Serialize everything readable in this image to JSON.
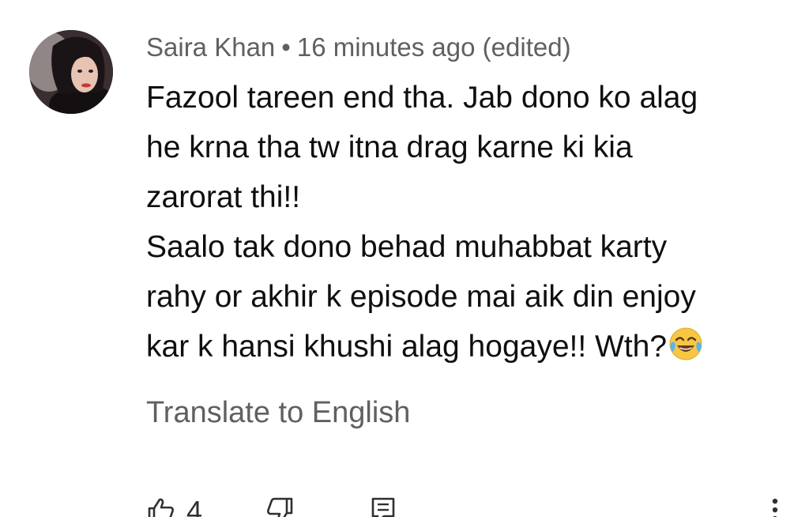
{
  "comment": {
    "author": "Saira Khan",
    "separator": "•",
    "timestamp": "16 minutes ago (edited)",
    "lines": [
      "Fazool tareen end tha. Jab dono ko alag",
      "he krna tha tw itna drag karne ki kia",
      "zarorat thi!!",
      "Saalo tak dono behad muhabbat karty",
      "rahy or akhir k episode mai aik din enjoy",
      "kar k hansi khushi alag hogaye!! Wth?"
    ],
    "emoji_icon": "face-with-tears-of-joy-icon",
    "translate_label": "Translate to English",
    "like_count": "4"
  },
  "icons": {
    "like": "thumbs-up-icon",
    "dislike": "thumbs-down-icon",
    "reply": "reply-icon",
    "more": "more-vert-icon"
  },
  "colors": {
    "primary_text": "#0f0f0f",
    "secondary_text": "#606060",
    "background": "#ffffff"
  }
}
